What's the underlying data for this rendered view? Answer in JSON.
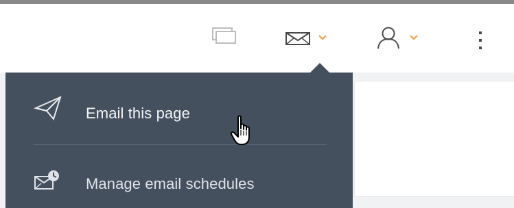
{
  "toolbar": {
    "items": [
      {
        "icon": "window-stack-icon"
      },
      {
        "icon": "envelope-icon",
        "dropdown": "chevron-down-icon"
      },
      {
        "icon": "user-icon",
        "dropdown": "chevron-down-icon"
      },
      {
        "icon": "vertical-ellipsis-icon"
      }
    ],
    "accent_color": "#f0a045"
  },
  "email_menu": {
    "items": [
      {
        "label": "Email this page",
        "icon": "paper-plane-icon"
      },
      {
        "label": "Manage email schedules",
        "icon": "email-clock-icon"
      }
    ],
    "background": "#45505f"
  }
}
